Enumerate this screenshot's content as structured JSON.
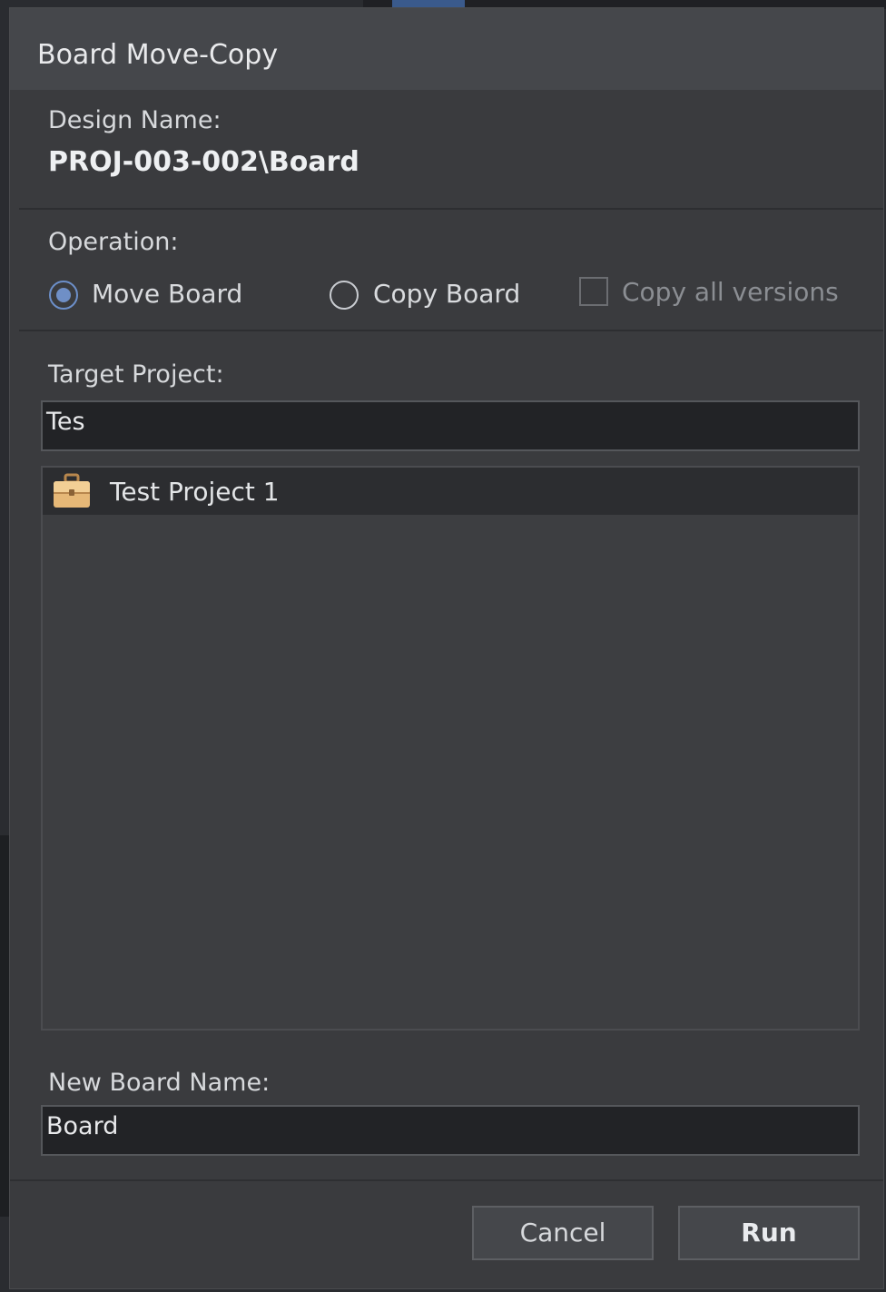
{
  "dialog": {
    "title": "Board Move-Copy",
    "design_name_label": "Design Name:",
    "design_name_value": "PROJ-003-002\\Board",
    "operation_label": "Operation:",
    "options": [
      {
        "label": "Move Board",
        "checked": true
      },
      {
        "label": "Copy Board",
        "checked": false
      }
    ],
    "copy_versions_label": "Copy all versions",
    "copy_versions_checked": false,
    "target_project_label": "Target Project:",
    "target_project_value": "Tes",
    "project_list": [
      {
        "label": "Test Project 1",
        "icon": "briefcase-icon"
      }
    ],
    "new_board_name_label": "New Board Name:",
    "new_board_name_value": "Board",
    "cancel_label": "Cancel",
    "run_label": "Run"
  },
  "colors": {
    "background": "#3a3b3e",
    "titlebar": "#45474b",
    "input_bg": "#222326",
    "radio_accent": "#6f8fc6"
  }
}
